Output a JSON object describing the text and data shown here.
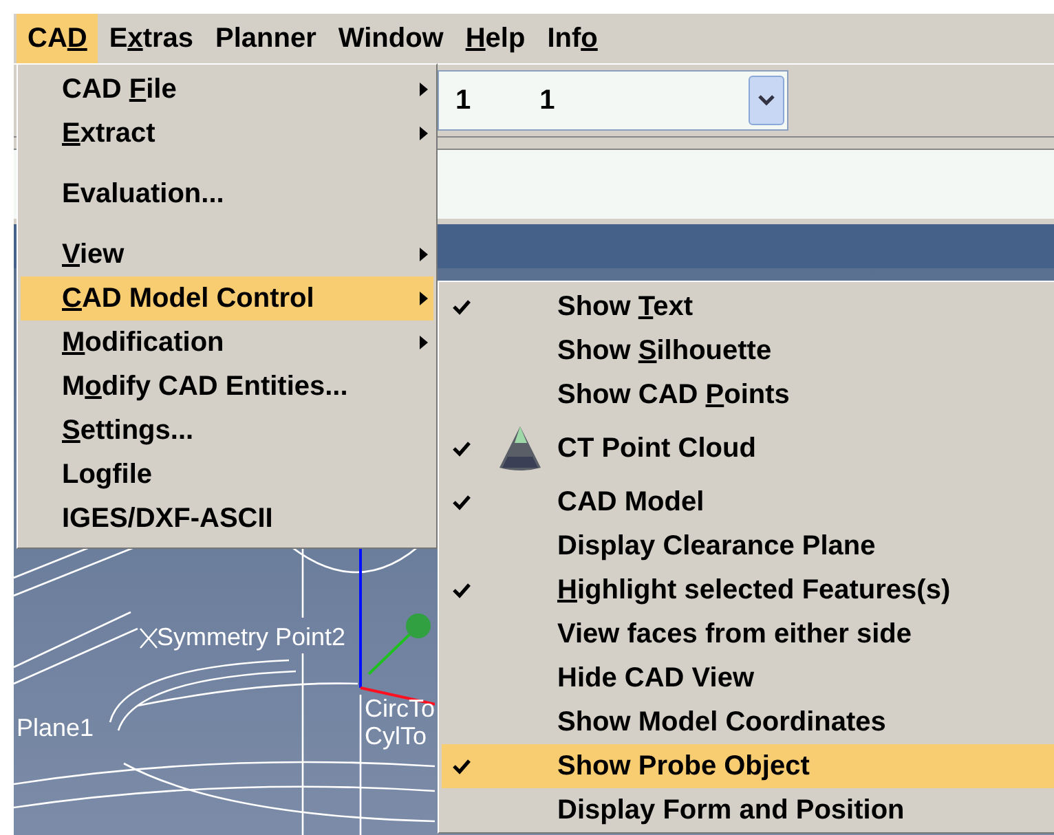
{
  "menu_bar": [
    {
      "label": {
        "pre": "CA",
        "key": "D"
      },
      "selected": true
    },
    {
      "label": {
        "pre": "E",
        "key": "x",
        "post": "tras"
      },
      "selected": false
    },
    {
      "label": {
        "pre": "Planner"
      },
      "selected": false
    },
    {
      "label": {
        "pre": "Window"
      },
      "selected": false
    },
    {
      "label": {
        "key": "H",
        "post": "elp"
      },
      "selected": false
    },
    {
      "label": {
        "pre": "Inf",
        "key": "o"
      },
      "selected": false
    }
  ],
  "toolbar": {
    "combo_values": [
      "1",
      "1"
    ]
  },
  "view": {
    "labels": [
      "Symmetry Point2",
      "Plane1",
      "CircTo",
      "CylTo"
    ]
  },
  "cad_menu": {
    "items": [
      {
        "kind": "item",
        "label": {
          "pre": "CAD ",
          "key": "F",
          "post": "ile"
        },
        "submenu": true,
        "selected": false
      },
      {
        "kind": "item",
        "label": {
          "key": "E",
          "post": "xtract"
        },
        "submenu": true,
        "selected": false
      },
      {
        "kind": "separator"
      },
      {
        "kind": "item",
        "label": {
          "pre": "Evaluation..."
        },
        "submenu": false,
        "selected": false
      },
      {
        "kind": "separator"
      },
      {
        "kind": "item",
        "label": {
          "key": "V",
          "post": "iew"
        },
        "submenu": true,
        "selected": false
      },
      {
        "kind": "item",
        "label": {
          "key": "C",
          "post": "AD Model Control"
        },
        "submenu": true,
        "selected": true
      },
      {
        "kind": "item",
        "label": {
          "key": "M",
          "post": "odification"
        },
        "submenu": true,
        "selected": false
      },
      {
        "kind": "item",
        "label": {
          "pre": "M",
          "key": "o",
          "post": "dify CAD Entities..."
        },
        "submenu": false,
        "selected": false
      },
      {
        "kind": "item",
        "label": {
          "key": "S",
          "post": "ettings..."
        },
        "submenu": false,
        "selected": false
      },
      {
        "kind": "item",
        "label": {
          "pre": "Logfile"
        },
        "submenu": false,
        "selected": false
      },
      {
        "kind": "item",
        "label": {
          "pre": "IGES/DXF-ASCII"
        },
        "submenu": false,
        "selected": false
      }
    ]
  },
  "submenu": {
    "items": [
      {
        "label": {
          "pre": "Show ",
          "key": "T",
          "post": "ext"
        },
        "checked": true,
        "has_icon": false,
        "selected": false
      },
      {
        "label": {
          "pre": "Show ",
          "key": "S",
          "post": "ilhouette"
        },
        "checked": false,
        "has_icon": false,
        "selected": false
      },
      {
        "label": {
          "pre": "Show CAD ",
          "key": "P",
          "post": "oints"
        },
        "checked": false,
        "has_icon": false,
        "selected": false
      },
      {
        "label": {
          "pre": "CT Point Cloud"
        },
        "checked": true,
        "has_icon": true,
        "selected": false
      },
      {
        "label": {
          "pre": "CAD Model"
        },
        "checked": true,
        "has_icon": false,
        "selected": false
      },
      {
        "label": {
          "pre": "Display Clearance Plane"
        },
        "checked": false,
        "has_icon": false,
        "selected": false
      },
      {
        "label": {
          "key": "H",
          "post": "ighlight selected Features(s)"
        },
        "checked": true,
        "has_icon": false,
        "selected": false
      },
      {
        "label": {
          "pre": "View faces from either side"
        },
        "checked": false,
        "has_icon": false,
        "selected": false
      },
      {
        "label": {
          "pre": "Hide CAD View"
        },
        "checked": false,
        "has_icon": false,
        "selected": false
      },
      {
        "label": {
          "pre": "Show Model Coordinates"
        },
        "checked": false,
        "has_icon": false,
        "selected": false
      },
      {
        "label": {
          "pre": "Show Probe Object"
        },
        "checked": true,
        "has_icon": false,
        "selected": true
      },
      {
        "label": {
          "pre": "Display Form and Position"
        },
        "checked": false,
        "has_icon": false,
        "selected": false
      }
    ]
  }
}
